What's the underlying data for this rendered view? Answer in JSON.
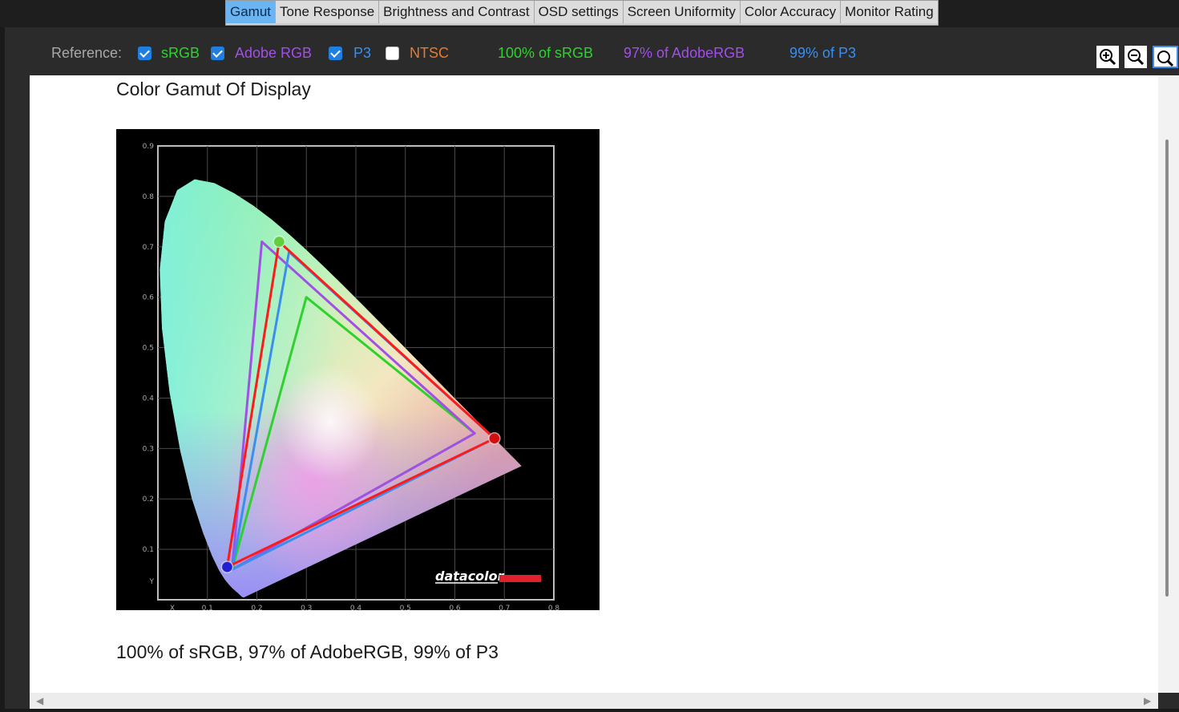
{
  "tabs": [
    {
      "label": "Gamut",
      "active": true
    },
    {
      "label": "Tone Response",
      "active": false
    },
    {
      "label": "Brightness and Contrast",
      "active": false
    },
    {
      "label": "OSD settings",
      "active": false
    },
    {
      "label": "Screen Uniformity",
      "active": false
    },
    {
      "label": "Color Accuracy",
      "active": false
    },
    {
      "label": "Monitor Rating",
      "active": false
    }
  ],
  "reference": {
    "label": "Reference:",
    "options": [
      {
        "label": "sRGB",
        "checked": true,
        "color": "#2fd12f"
      },
      {
        "label": "Adobe RGB",
        "checked": true,
        "color": "#a24fe8"
      },
      {
        "label": "P3",
        "checked": true,
        "color": "#3a8ef0"
      },
      {
        "label": "NTSC",
        "checked": false,
        "color": "#e87a2f"
      }
    ],
    "results": [
      {
        "text": "100% of sRGB",
        "color": "#2fd12f"
      },
      {
        "text": "97% of AdobeRGB",
        "color": "#a24fe8"
      },
      {
        "text": "99% of P3",
        "color": "#3a8ef0"
      }
    ]
  },
  "zoom_buttons": [
    "zoom-in-icon",
    "zoom-out-icon",
    "zoom-reset-icon"
  ],
  "main": {
    "title": "Color Gamut Of Display",
    "summary": "100% of sRGB, 97% of AdobeRGB, 99% of P3"
  },
  "chart_data": {
    "type": "scatter",
    "title": "",
    "xlabel": "X",
    "ylabel": "Y",
    "xlim": [
      0,
      0.8
    ],
    "ylim": [
      0,
      0.9
    ],
    "x_ticks": [
      "0.1",
      "0.2",
      "0.3",
      "0.4",
      "0.5",
      "0.6",
      "0.7",
      "0.8"
    ],
    "y_ticks": [
      "0.1",
      "0.2",
      "0.3",
      "0.4",
      "0.5",
      "0.6",
      "0.7",
      "0.8",
      "0.9"
    ],
    "grid": true,
    "watermark": "datacolor",
    "series": [
      {
        "name": "sRGB",
        "color": "#2fd12f",
        "points": [
          [
            0.64,
            0.33
          ],
          [
            0.3,
            0.6
          ],
          [
            0.15,
            0.06
          ]
        ]
      },
      {
        "name": "Adobe RGB",
        "color": "#a24fe8",
        "points": [
          [
            0.64,
            0.33
          ],
          [
            0.21,
            0.71
          ],
          [
            0.15,
            0.06
          ]
        ]
      },
      {
        "name": "P3",
        "color": "#3a8ef0",
        "points": [
          [
            0.68,
            0.32
          ],
          [
            0.265,
            0.69
          ],
          [
            0.15,
            0.06
          ]
        ]
      },
      {
        "name": "Display",
        "color": "#ff1a1a",
        "points": [
          [
            0.68,
            0.32
          ],
          [
            0.245,
            0.71
          ],
          [
            0.14,
            0.065
          ]
        ]
      }
    ],
    "primaries": [
      {
        "name": "red",
        "x": 0.68,
        "y": 0.32,
        "color": "#d01010"
      },
      {
        "name": "green",
        "x": 0.245,
        "y": 0.71,
        "color": "#5fcf3f"
      },
      {
        "name": "blue",
        "x": 0.14,
        "y": 0.065,
        "color": "#2020d0"
      }
    ],
    "locus": [
      [
        0.1741,
        0.005
      ],
      [
        0.1733,
        0.0048
      ],
      [
        0.1726,
        0.0048
      ],
      [
        0.1721,
        0.0048
      ],
      [
        0.1714,
        0.0051
      ],
      [
        0.1703,
        0.0058
      ],
      [
        0.1689,
        0.0069
      ],
      [
        0.1669,
        0.0086
      ],
      [
        0.1644,
        0.0109
      ],
      [
        0.1611,
        0.0138
      ],
      [
        0.1566,
        0.0177
      ],
      [
        0.151,
        0.0227
      ],
      [
        0.144,
        0.0297
      ],
      [
        0.1355,
        0.0399
      ],
      [
        0.1241,
        0.0578
      ],
      [
        0.1096,
        0.0868
      ],
      [
        0.0913,
        0.1327
      ],
      [
        0.0687,
        0.2007
      ],
      [
        0.0454,
        0.295
      ],
      [
        0.0235,
        0.4127
      ],
      [
        0.0082,
        0.5384
      ],
      [
        0.0039,
        0.6548
      ],
      [
        0.0139,
        0.7502
      ],
      [
        0.0389,
        0.812
      ],
      [
        0.0743,
        0.8338
      ],
      [
        0.1142,
        0.8262
      ],
      [
        0.1547,
        0.8059
      ],
      [
        0.1929,
        0.7816
      ],
      [
        0.2296,
        0.7543
      ],
      [
        0.2658,
        0.7243
      ],
      [
        0.3016,
        0.6923
      ],
      [
        0.3373,
        0.6589
      ],
      [
        0.3731,
        0.6245
      ],
      [
        0.4087,
        0.5896
      ],
      [
        0.4441,
        0.5547
      ],
      [
        0.4788,
        0.5202
      ],
      [
        0.5125,
        0.4866
      ],
      [
        0.5448,
        0.4544
      ],
      [
        0.5752,
        0.4242
      ],
      [
        0.6029,
        0.3965
      ],
      [
        0.627,
        0.3725
      ],
      [
        0.6482,
        0.3514
      ],
      [
        0.6658,
        0.334
      ],
      [
        0.6801,
        0.3197
      ],
      [
        0.6915,
        0.3083
      ],
      [
        0.7006,
        0.2993
      ],
      [
        0.7079,
        0.292
      ],
      [
        0.714,
        0.2859
      ],
      [
        0.719,
        0.2809
      ],
      [
        0.723,
        0.277
      ],
      [
        0.726,
        0.274
      ],
      [
        0.7283,
        0.2717
      ],
      [
        0.7347,
        0.2653
      ]
    ]
  }
}
